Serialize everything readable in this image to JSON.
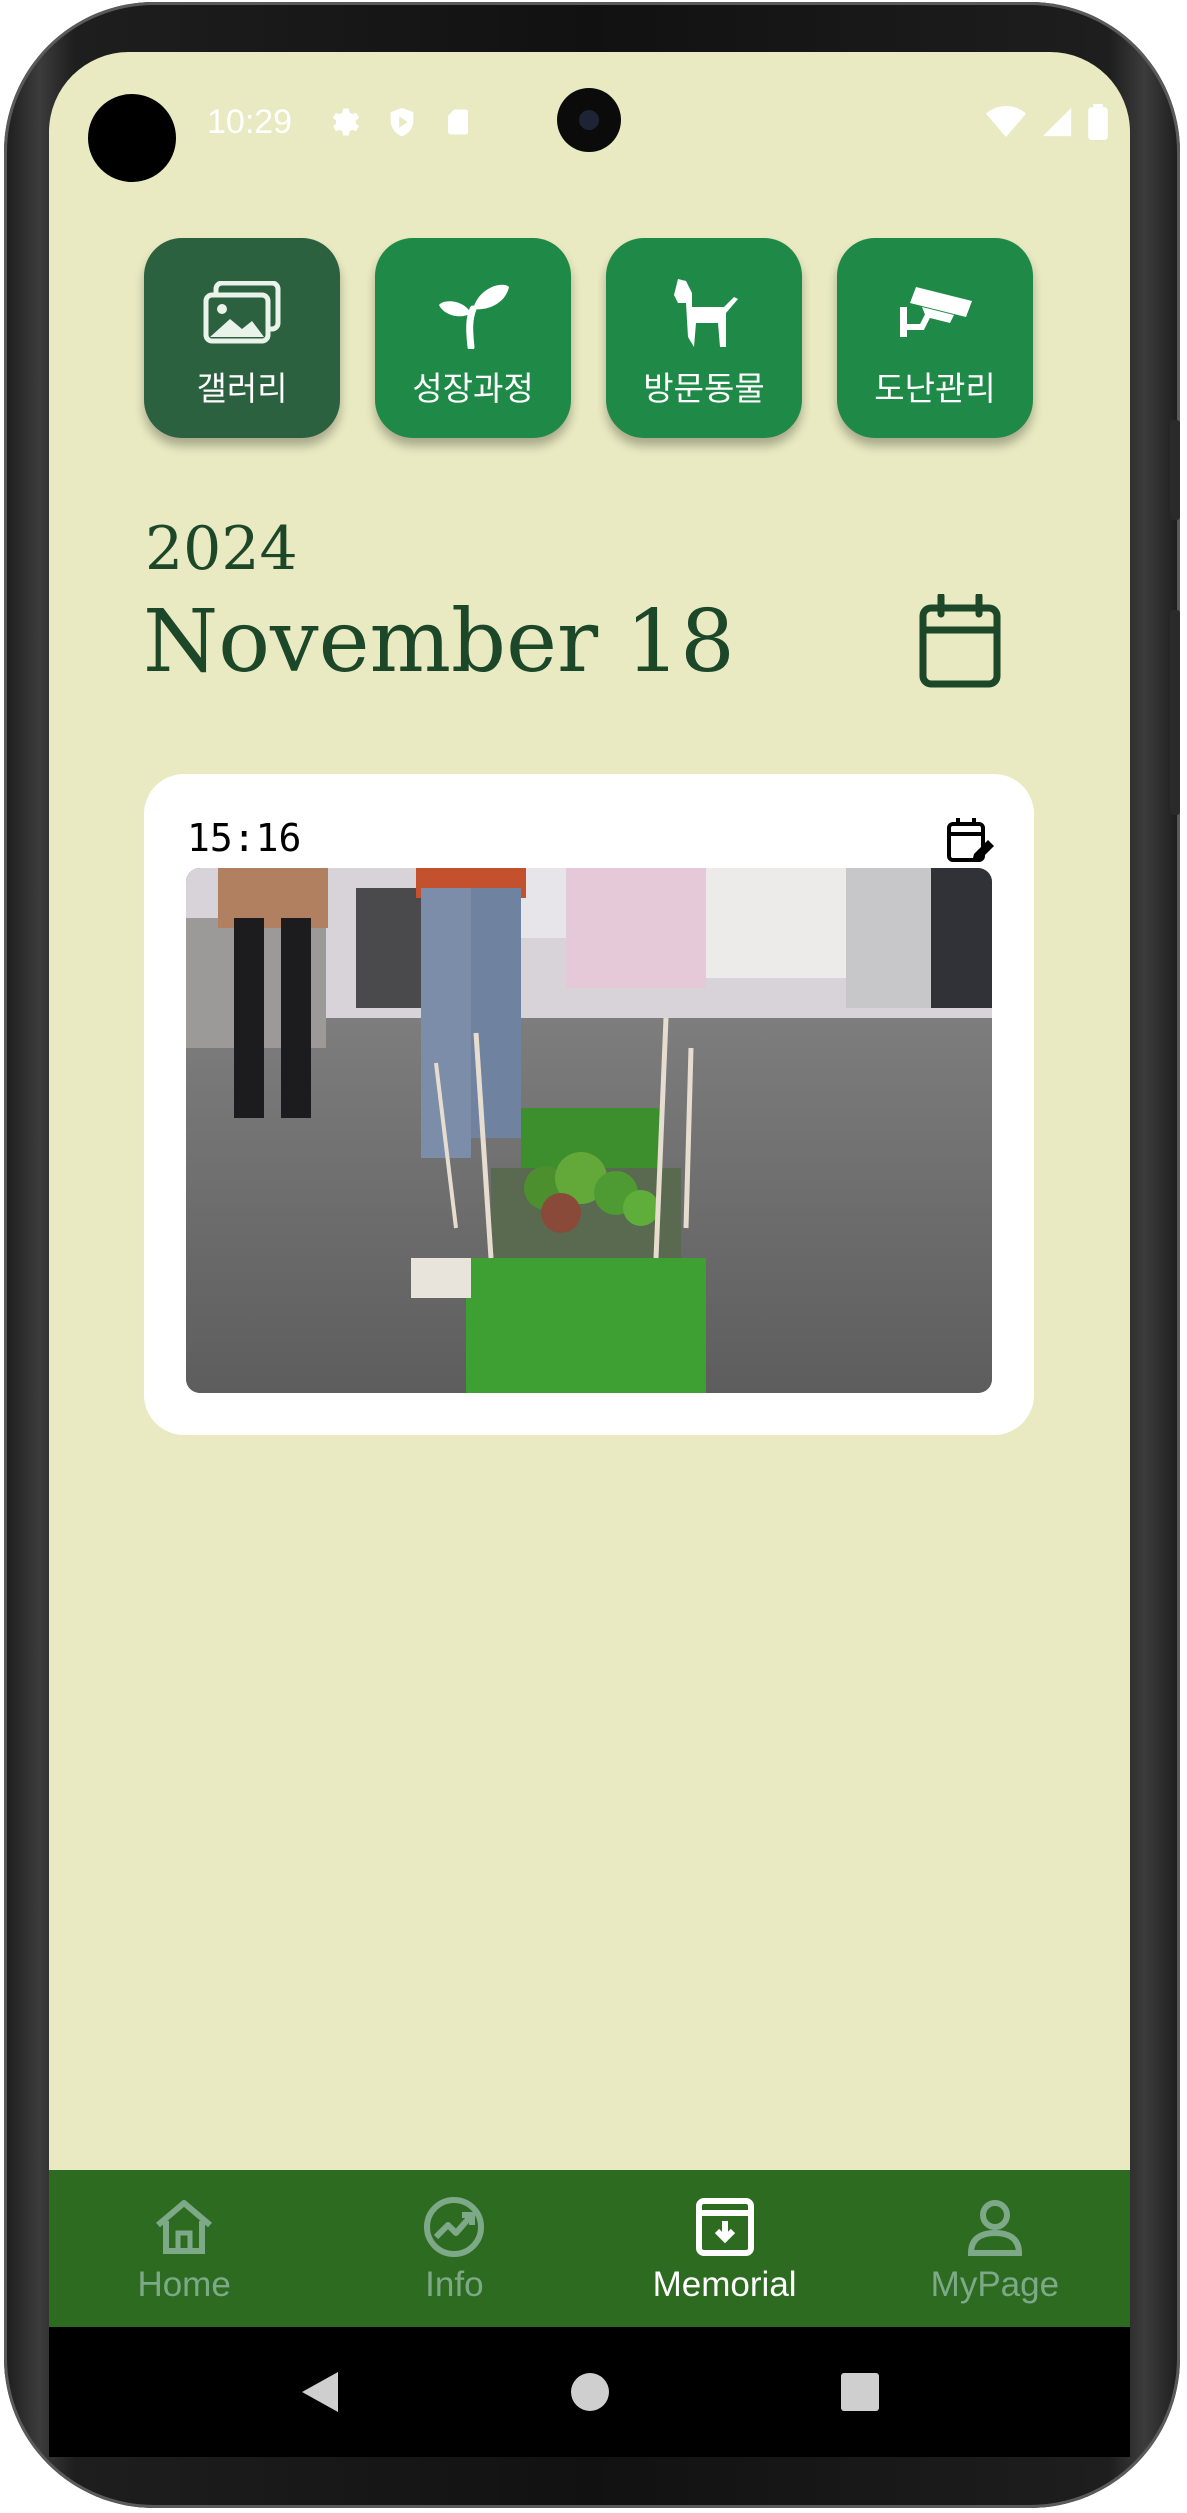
{
  "status_bar": {
    "time": "10:29"
  },
  "tiles": [
    {
      "label": "갤러리",
      "icon": "gallery-icon"
    },
    {
      "label": "성장과정",
      "icon": "sprout-icon"
    },
    {
      "label": "방문동물",
      "icon": "dog-icon"
    },
    {
      "label": "도난관리",
      "icon": "cctv-icon"
    }
  ],
  "header": {
    "year": "2024",
    "date": "November 18"
  },
  "entry": {
    "time": "15:16",
    "photo_alt": "planter photo"
  },
  "nav": {
    "items": [
      {
        "label": "Home",
        "icon": "home-icon"
      },
      {
        "label": "Info",
        "icon": "chart-icon"
      },
      {
        "label": "Memorial",
        "icon": "archive-icon"
      },
      {
        "label": "MyPage",
        "icon": "person-icon"
      }
    ],
    "active": "Memorial"
  },
  "colors": {
    "background": "#e9eac1",
    "tile": "#1f8a48",
    "tile_active": "#2c6140",
    "date_text": "#1c4728",
    "nav_bar": "#2d6c20",
    "nav_inactive": "#7ea988"
  }
}
